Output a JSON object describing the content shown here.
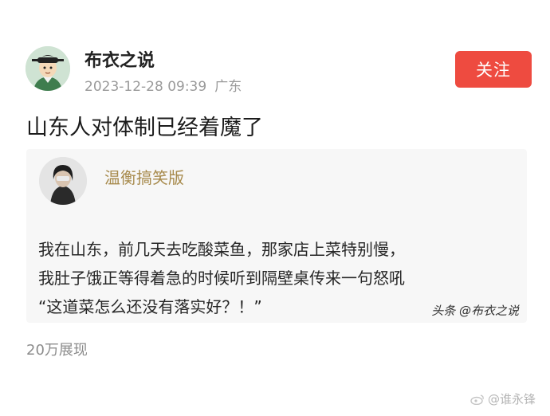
{
  "post": {
    "author": "布衣之说",
    "timestamp": "2023-12-28 09:39",
    "location": "广东",
    "follow_label": "关注",
    "text": "山东人对体制已经着魔了",
    "views": "20万展现"
  },
  "quote": {
    "author": "温衡搞笑版",
    "lines": [
      "我在山东，前几天去吃酸菜鱼，那家店上菜特别慢，",
      "我肚子饿正等得着急的时候听到隔壁桌传来一句怒吼",
      "“这道菜怎么还没有落实好？！”"
    ],
    "source_tag": "头条 @布衣之说"
  },
  "watermark": "@谁永锋",
  "colors": {
    "accent": "#ee4b40",
    "quote_name": "#a78a4c"
  }
}
